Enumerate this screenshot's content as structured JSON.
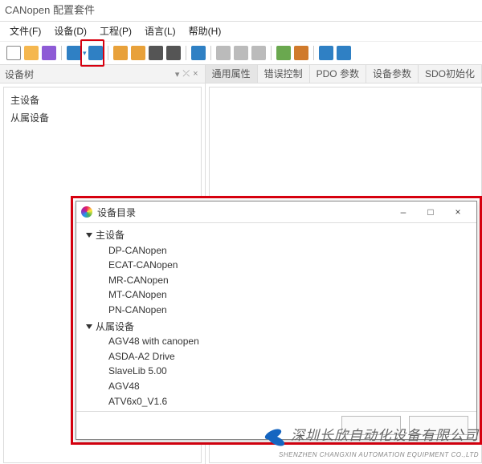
{
  "window": {
    "title": "CANopen 配置套件"
  },
  "menu": {
    "file": "文件(F)",
    "device": "设备(D)",
    "project": "工程(P)",
    "language": "语言(L)",
    "help": "帮助(H)"
  },
  "toolbar": {
    "icons": [
      {
        "name": "new-icon",
        "c": "#ffffff",
        "b": "#888"
      },
      {
        "name": "open-icon",
        "c": "#f5b74f"
      },
      {
        "name": "save-icon",
        "c": "#8e5bd6"
      },
      {
        "name": "tree-icon",
        "c": "#2f80c4"
      },
      {
        "name": "insert-icon",
        "c": "#2f80c4"
      },
      {
        "name": "edit-icon",
        "c": "#e8a13a"
      },
      {
        "name": "folder-open-icon",
        "c": "#e8a13a"
      },
      {
        "name": "wand-icon",
        "c": "#555"
      },
      {
        "name": "gear-icon",
        "c": "#555"
      },
      {
        "name": "refresh-sync-icon",
        "c": "#2f80c4"
      },
      {
        "name": "stop-icon",
        "c": "#bbb"
      },
      {
        "name": "play-icon",
        "c": "#bbb"
      },
      {
        "name": "pause-icon",
        "c": "#bbb"
      },
      {
        "name": "save2-icon",
        "c": "#6aa84f"
      },
      {
        "name": "export-icon",
        "c": "#d07a2c"
      },
      {
        "name": "table-icon",
        "c": "#2f80c4"
      },
      {
        "name": "help-icon",
        "c": "#2f80c4"
      }
    ],
    "highlight_index": 3
  },
  "devtree": {
    "title": "设备树",
    "items": [
      "主设备",
      "从属设备"
    ]
  },
  "tabs": [
    "通用属性",
    "错误控制",
    "PDO 参数",
    "设备参数",
    "SDO初始化"
  ],
  "active_tab": 0,
  "dialog": {
    "title": "设备目录",
    "groups": [
      {
        "name": "主设备",
        "items": [
          "DP-CANopen",
          "ECAT-CANopen",
          "MR-CANopen",
          "MT-CANopen",
          "PN-CANopen"
        ]
      },
      {
        "name": "从属设备",
        "items": [
          "AGV48 with canopen",
          "ASDA-A2 Drive",
          "SlaveLib 5.00",
          "AGV48",
          "ATV6x0_V1.6"
        ]
      }
    ],
    "min": "–",
    "max": "□",
    "close": "×"
  },
  "watermark": {
    "line1": "深圳长欣自动化设备有限公司",
    "line2": "SHENZHEN CHANGXIN AUTOMATION EQUIPMENT CO.,LTD"
  }
}
